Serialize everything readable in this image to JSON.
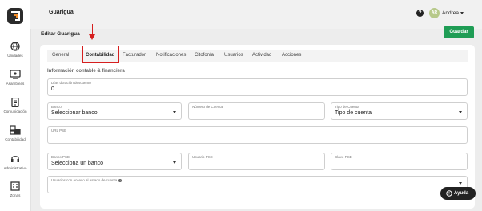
{
  "app": {
    "title": "Guarigua"
  },
  "user": {
    "initials": "AR",
    "name": "Andrea"
  },
  "page": {
    "title": "Editar Guarigua",
    "save_label": "Guardar"
  },
  "sidebar": {
    "items": [
      {
        "label": "Unidades",
        "icon": "globe-icon"
      },
      {
        "label": "Asambleas",
        "icon": "assembly-icon"
      },
      {
        "label": "Comunicación",
        "icon": "document-icon"
      },
      {
        "label": "Contabilidad",
        "icon": "accounting-icon"
      },
      {
        "label": "Administrativo",
        "icon": "headset-icon"
      },
      {
        "label": "Zonas",
        "icon": "building-icon"
      }
    ]
  },
  "tabs": [
    {
      "label": "General"
    },
    {
      "label": "Contabilidad"
    },
    {
      "label": "Facturador"
    },
    {
      "label": "Notificaciones"
    },
    {
      "label": "Citofonía"
    },
    {
      "label": "Usuarios"
    },
    {
      "label": "Actividad"
    },
    {
      "label": "Acciones"
    }
  ],
  "form": {
    "section_title": "Información contable & financiera",
    "dias_label": "Días duración descuento",
    "dias_value": "0",
    "banco_label": "Banco",
    "banco_value": "Seleccionar banco",
    "numero_cuenta_label": "Número de Cuenta",
    "numero_cuenta_value": "",
    "tipo_cuenta_label": "Tipo de Cuenta",
    "tipo_cuenta_value": "Tipo de cuenta",
    "url_pse_label": "URL PSE",
    "url_pse_value": "",
    "banco_pse_label": "Banco PSE",
    "banco_pse_value": "Selecciona un banco",
    "usuario_pse_label": "Usuario PSE",
    "usuario_pse_value": "",
    "clave_pse_label": "Clave PSE",
    "clave_pse_value": "",
    "usuarios_acceso_label": "Usuarios con acceso al estado de cuenta",
    "usuarios_acceso_info": "i"
  },
  "help": {
    "label": "Ayuda",
    "glyph": "?"
  },
  "colors": {
    "accent": "#1f9d55",
    "highlight": "#d61f1f"
  }
}
